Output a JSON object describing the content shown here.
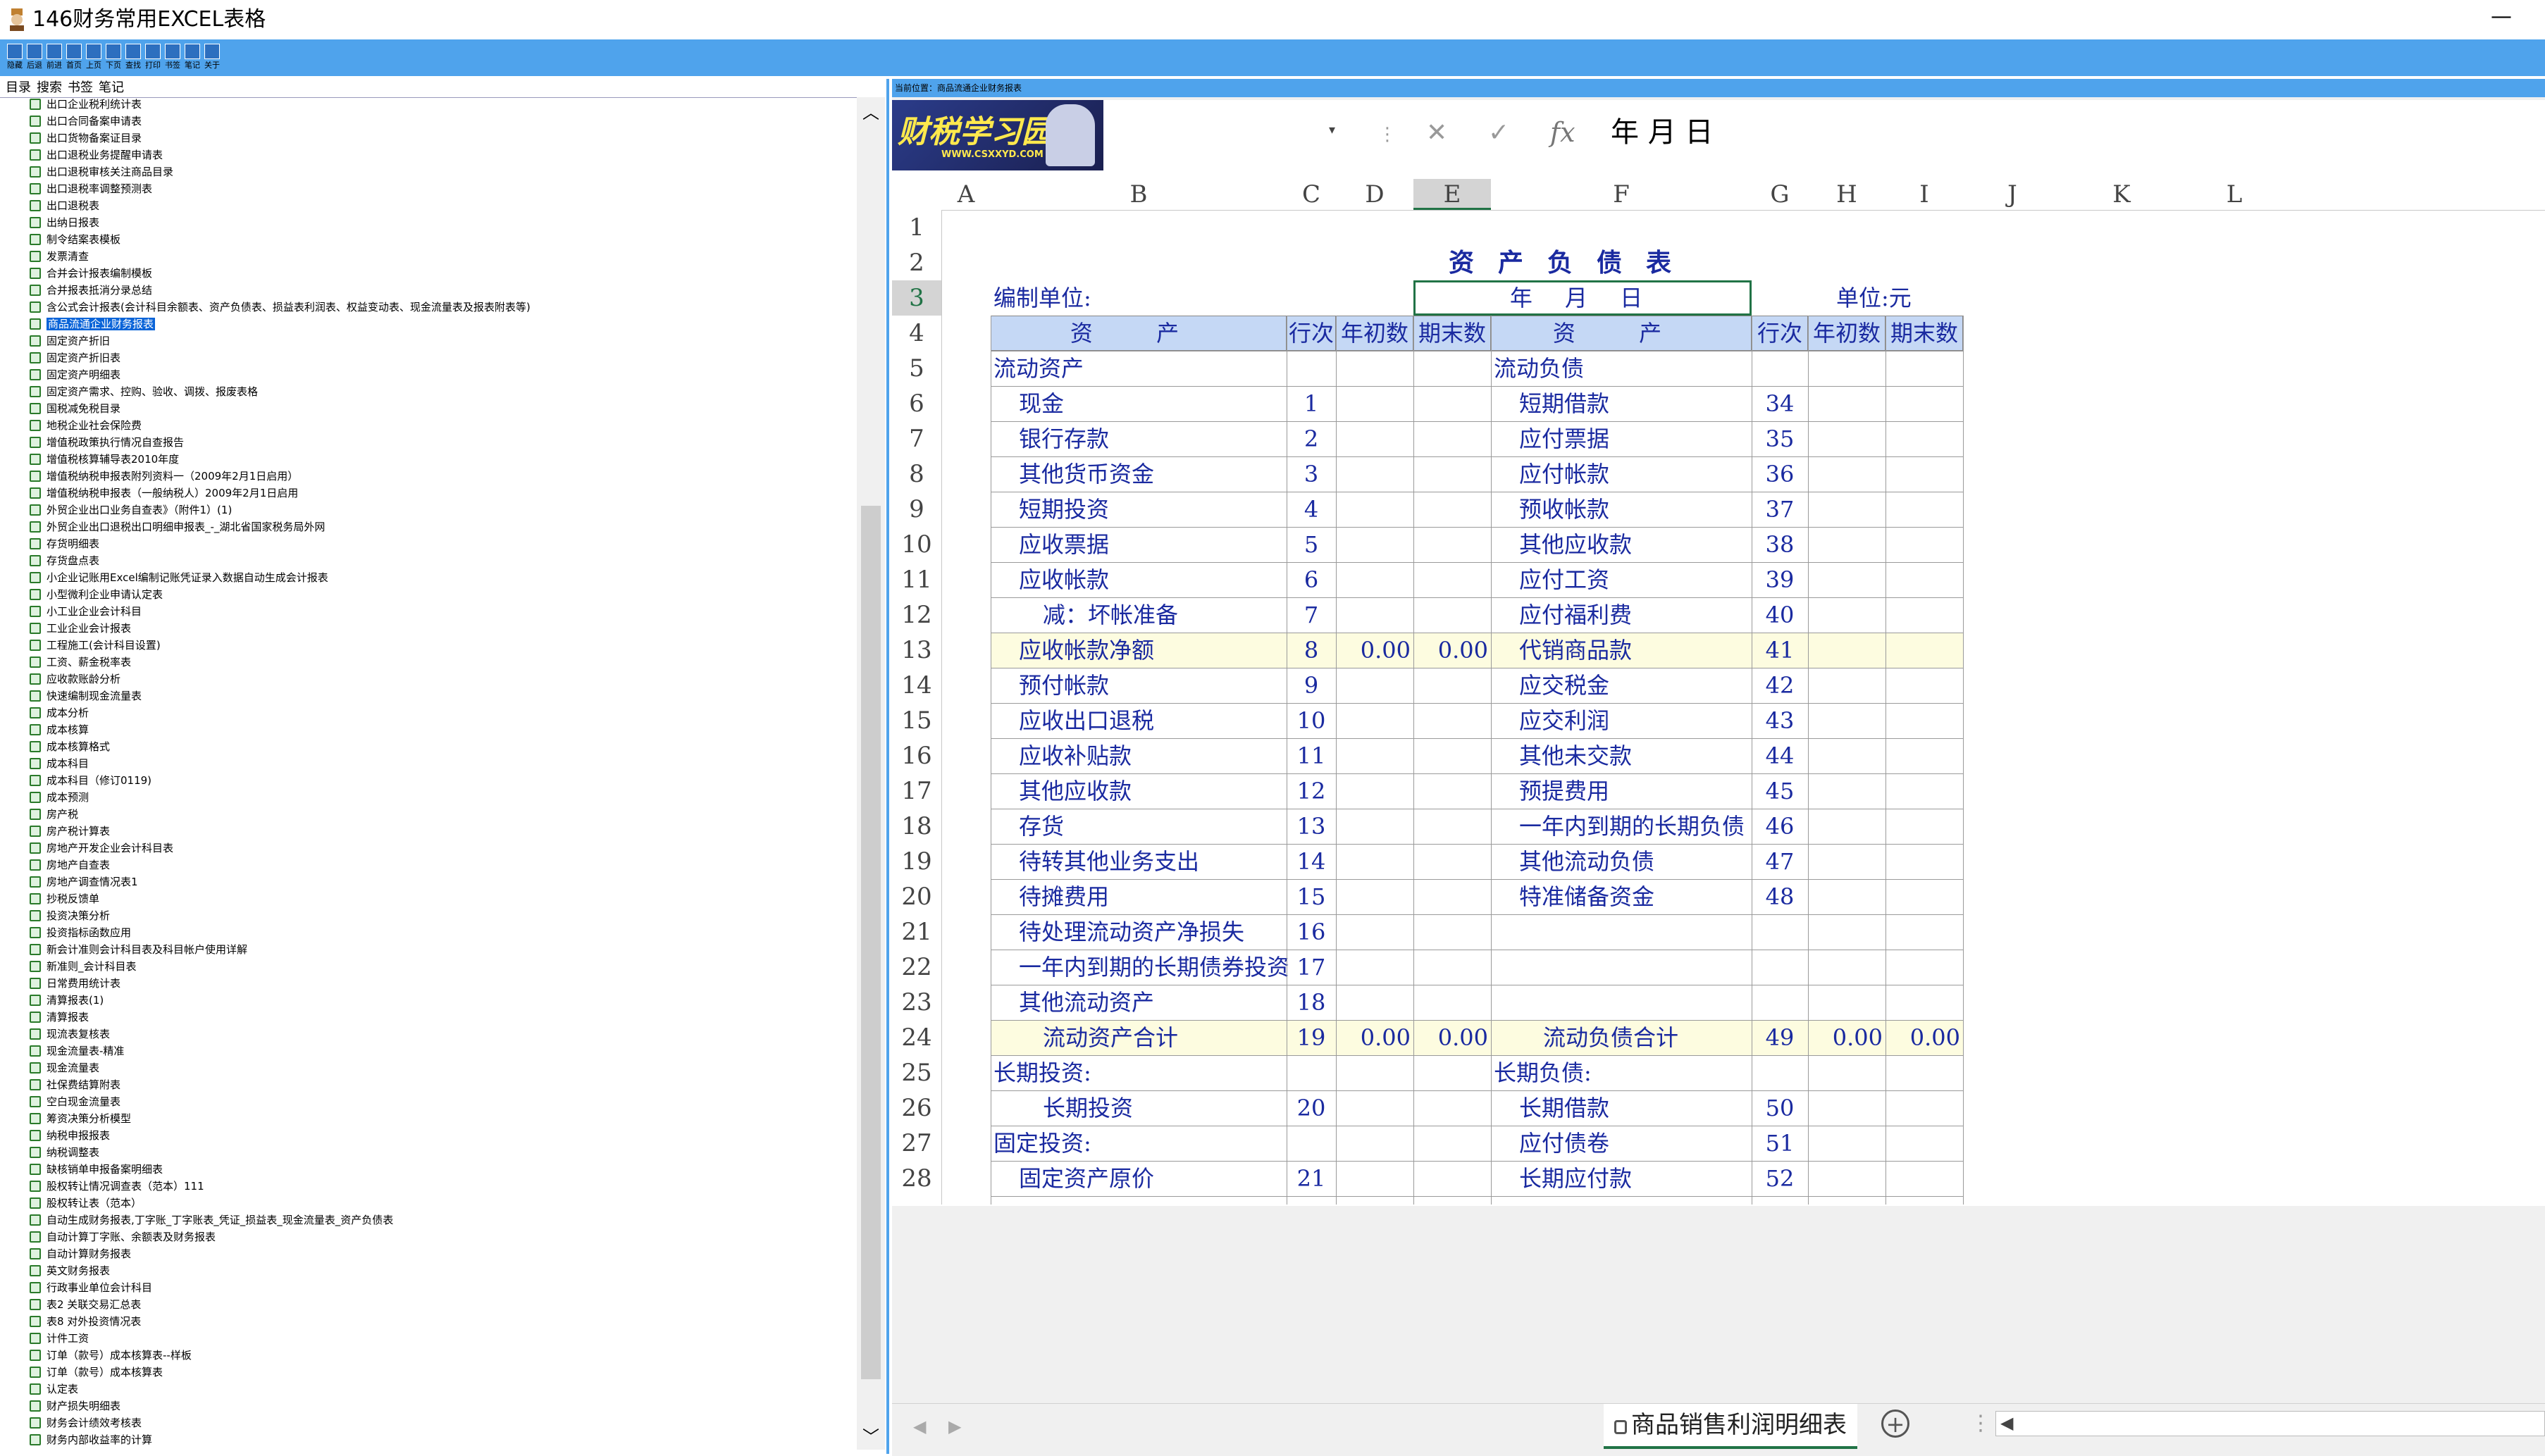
{
  "window": {
    "title": "146财务常用EXCEL表格",
    "minimize": "—"
  },
  "toolbar": {
    "buttons": [
      {
        "label": "隐藏",
        "icon": "hide-icon"
      },
      {
        "label": "后退",
        "icon": "back-icon"
      },
      {
        "label": "前进",
        "icon": "forward-icon"
      },
      {
        "label": "首页",
        "icon": "home-icon"
      },
      {
        "label": "上页",
        "icon": "prev-page-icon"
      },
      {
        "label": "下页",
        "icon": "next-page-icon"
      },
      {
        "label": "查找",
        "icon": "search-icon"
      },
      {
        "label": "打印",
        "icon": "print-icon"
      },
      {
        "label": "书签",
        "icon": "bookmark-icon"
      },
      {
        "label": "笔记",
        "icon": "note-icon"
      },
      {
        "label": "关于",
        "icon": "about-icon"
      }
    ]
  },
  "tree": {
    "tabs": [
      "目录",
      "搜索",
      "书签",
      "笔记"
    ],
    "items": [
      "出口企业税利统计表",
      "出口合同备案申请表",
      "出口货物备案证目录",
      "出口退税业务提醒申请表",
      "出口退税审核关注商品目录",
      "出口退税率调整预测表",
      "出口退税表",
      "出纳日报表",
      "制令结案表模板",
      "发票清查",
      "合并会计报表编制模板",
      "合并报表抵消分录总结",
      "含公式会计报表(会计科目余额表、资产负债表、损益表利润表、权益变动表、现金流量表及报表附表等)",
      "商品流通企业财务报表",
      "固定资产折旧",
      "固定资产折旧表",
      "固定资产明细表",
      "固定资产需求、控购、验收、调拨、报废表格",
      "国税减免税目录",
      "地税企业社会保险费",
      "增值税政策执行情况自查报告",
      "增值税核算辅导表2010年度",
      "增值税纳税申报表附列资料一（2009年2月1日启用）",
      "增值税纳税申报表（一般纳税人）2009年2月1日启用",
      "外贸企业出口业务自查表》（附件1）(1)",
      "外贸企业出口退税出口明细申报表_-_湖北省国家税务局外网",
      "存货明细表",
      "存货盘点表",
      "小企业记账用Excel编制记账凭证录入数据自动生成会计报表",
      "小型微利企业申请认定表",
      "小工业企业会计科目",
      "工业企业会计报表",
      "工程施工(会计科目设置)",
      "工资、薪金税率表",
      "应收款账龄分析",
      "快速编制现金流量表",
      "成本分析",
      "成本核算",
      "成本核算格式",
      "成本科目",
      "成本科目（修订0119)",
      "成本预测",
      "房产税",
      "房产税计算表",
      "房地产开发企业会计科目表",
      "房地产自查表",
      "房地产调查情况表1",
      "抄税反馈单",
      "投资决策分析",
      "投资指标函数应用",
      "新会计准则会计科目表及科目帐户使用详解",
      "新准则_会计科目表",
      "日常费用统计表",
      "清算报表(1)",
      "清算报表",
      "现流表复核表",
      "现金流量表-精准",
      "现金流量表",
      "社保费结算附表",
      "空白现金流量表",
      "筹资决策分析模型",
      "纳税申报报表",
      "纳税调整表",
      "缺核销单申报备案明细表",
      "股权转让情况调查表（范本）111",
      "股权转让表（范本）",
      "自动生成财务报表,丁字账_丁字账表_凭证_损益表_现金流量表_资产负债表",
      "自动计算丁字账、余额表及财务报表",
      "自动计算财务报表",
      "英文财务报表",
      "行政事业单位会计科目",
      "表2 关联交易汇总表",
      "表8 对外投资情况表",
      "计件工资",
      "订单（款号）成本核算表--样板",
      "订单（款号）成本核算表",
      "认定表",
      "财产损失明细表",
      "财务会计绩效考核表",
      "财务内部收益率的计算"
    ],
    "selected_index": 13
  },
  "location_bar": "当前位置：商品流通企业财务报表",
  "logo": {
    "text": "财税学习园地",
    "url_text": "WWW.CSXXYD.COM"
  },
  "formula_bar": {
    "cancel": "✕",
    "confirm": "✓",
    "fx": "fx",
    "value": "年 月 日"
  },
  "columns": [
    "A",
    "B",
    "C",
    "D",
    "E",
    "F",
    "G",
    "H",
    "I",
    "J",
    "K",
    "L"
  ],
  "active_column": "E",
  "rows": [
    "1",
    "2",
    "3",
    "4",
    "5",
    "6",
    "7",
    "8",
    "9",
    "10",
    "11",
    "12",
    "13",
    "14",
    "15",
    "16",
    "17",
    "18",
    "19",
    "20",
    "21",
    "22",
    "23",
    "24",
    "25",
    "26",
    "27",
    "28"
  ],
  "active_row": "3",
  "sheet": {
    "title": "资产负债表",
    "unit_label": "编制单位:",
    "date_placeholder": "年 月 日",
    "currency_label": "单位:元",
    "header": {
      "asset": "资 产",
      "line_no": "行次",
      "begin": "年初数",
      "end": "期末数",
      "liab": "资 产",
      "line_no2": "行次",
      "begin2": "年初数",
      "end2": "期末数"
    },
    "body": [
      {
        "a": "流动资产",
        "an": "",
        "ab": "",
        "ae": "",
        "l": "流动负债",
        "ln": "",
        "lb": "",
        "le": "",
        "a_indent": 0,
        "l_indent": 0,
        "yellow": false
      },
      {
        "a": "现金",
        "an": "1",
        "ab": "",
        "ae": "",
        "l": "短期借款",
        "ln": "34",
        "lb": "",
        "le": "",
        "a_indent": 1,
        "l_indent": 1,
        "yellow": false
      },
      {
        "a": "银行存款",
        "an": "2",
        "ab": "",
        "ae": "",
        "l": "应付票据",
        "ln": "35",
        "lb": "",
        "le": "",
        "a_indent": 1,
        "l_indent": 1,
        "yellow": false
      },
      {
        "a": "其他货币资金",
        "an": "3",
        "ab": "",
        "ae": "",
        "l": "应付帐款",
        "ln": "36",
        "lb": "",
        "le": "",
        "a_indent": 1,
        "l_indent": 1,
        "yellow": false
      },
      {
        "a": "短期投资",
        "an": "4",
        "ab": "",
        "ae": "",
        "l": "预收帐款",
        "ln": "37",
        "lb": "",
        "le": "",
        "a_indent": 1,
        "l_indent": 1,
        "yellow": false
      },
      {
        "a": "应收票据",
        "an": "5",
        "ab": "",
        "ae": "",
        "l": "其他应收款",
        "ln": "38",
        "lb": "",
        "le": "",
        "a_indent": 1,
        "l_indent": 1,
        "yellow": false
      },
      {
        "a": "应收帐款",
        "an": "6",
        "ab": "",
        "ae": "",
        "l": "应付工资",
        "ln": "39",
        "lb": "",
        "le": "",
        "a_indent": 1,
        "l_indent": 1,
        "yellow": false
      },
      {
        "a": "减：坏帐准备",
        "an": "7",
        "ab": "",
        "ae": "",
        "l": "应付福利费",
        "ln": "40",
        "lb": "",
        "le": "",
        "a_indent": 2,
        "l_indent": 1,
        "yellow": false
      },
      {
        "a": "应收帐款净额",
        "an": "8",
        "ab": "0.00",
        "ae": "0.00",
        "l": "代销商品款",
        "ln": "41",
        "lb": "",
        "le": "",
        "a_indent": 1,
        "l_indent": 1,
        "yellow": true
      },
      {
        "a": "预付帐款",
        "an": "9",
        "ab": "",
        "ae": "",
        "l": "应交税金",
        "ln": "42",
        "lb": "",
        "le": "",
        "a_indent": 1,
        "l_indent": 1,
        "yellow": false
      },
      {
        "a": "应收出口退税",
        "an": "10",
        "ab": "",
        "ae": "",
        "l": "应交利润",
        "ln": "43",
        "lb": "",
        "le": "",
        "a_indent": 1,
        "l_indent": 1,
        "yellow": false
      },
      {
        "a": "应收补贴款",
        "an": "11",
        "ab": "",
        "ae": "",
        "l": "其他未交款",
        "ln": "44",
        "lb": "",
        "le": "",
        "a_indent": 1,
        "l_indent": 1,
        "yellow": false
      },
      {
        "a": "其他应收款",
        "an": "12",
        "ab": "",
        "ae": "",
        "l": "预提费用",
        "ln": "45",
        "lb": "",
        "le": "",
        "a_indent": 1,
        "l_indent": 1,
        "yellow": false
      },
      {
        "a": "存货",
        "an": "13",
        "ab": "",
        "ae": "",
        "l": "一年内到期的长期负债",
        "ln": "46",
        "lb": "",
        "le": "",
        "a_indent": 1,
        "l_indent": 1,
        "yellow": false
      },
      {
        "a": "待转其他业务支出",
        "an": "14",
        "ab": "",
        "ae": "",
        "l": "其他流动负债",
        "ln": "47",
        "lb": "",
        "le": "",
        "a_indent": 1,
        "l_indent": 1,
        "yellow": false
      },
      {
        "a": "待摊费用",
        "an": "15",
        "ab": "",
        "ae": "",
        "l": "特准储备资金",
        "ln": "48",
        "lb": "",
        "le": "",
        "a_indent": 1,
        "l_indent": 1,
        "yellow": false
      },
      {
        "a": "待处理流动资产净损失",
        "an": "16",
        "ab": "",
        "ae": "",
        "l": "",
        "ln": "",
        "lb": "",
        "le": "",
        "a_indent": 1,
        "l_indent": 1,
        "yellow": false
      },
      {
        "a": "一年内到期的长期债券投资",
        "an": "17",
        "ab": "",
        "ae": "",
        "l": "",
        "ln": "",
        "lb": "",
        "le": "",
        "a_indent": 1,
        "l_indent": 1,
        "yellow": false
      },
      {
        "a": "其他流动资产",
        "an": "18",
        "ab": "",
        "ae": "",
        "l": "",
        "ln": "",
        "lb": "",
        "le": "",
        "a_indent": 1,
        "l_indent": 1,
        "yellow": false
      },
      {
        "a": "流动资产合计",
        "an": "19",
        "ab": "0.00",
        "ae": "0.00",
        "l": "流动负债合计",
        "ln": "49",
        "lb": "0.00",
        "le": "0.00",
        "a_indent": 2,
        "l_indent": 2,
        "yellow": true
      },
      {
        "a": "长期投资:",
        "an": "",
        "ab": "",
        "ae": "",
        "l": "长期负债:",
        "ln": "",
        "lb": "",
        "le": "",
        "a_indent": 0,
        "l_indent": 0,
        "yellow": false
      },
      {
        "a": "长期投资",
        "an": "20",
        "ab": "",
        "ae": "",
        "l": "长期借款",
        "ln": "50",
        "lb": "",
        "le": "",
        "a_indent": 2,
        "l_indent": 1,
        "yellow": false
      },
      {
        "a": "固定投资:",
        "an": "",
        "ab": "",
        "ae": "",
        "l": "应付债卷",
        "ln": "51",
        "lb": "",
        "le": "",
        "a_indent": 0,
        "l_indent": 1,
        "yellow": false
      },
      {
        "a": "固定资产原价",
        "an": "21",
        "ab": "",
        "ae": "",
        "l": "长期应付款",
        "ln": "52",
        "lb": "",
        "le": "",
        "a_indent": 1,
        "l_indent": 1,
        "yellow": false
      }
    ]
  },
  "tabbar": {
    "sheet_name": "商品销售利润明细表",
    "add": "+",
    "dots": "⋮",
    "prev": "◀",
    "next": "▶",
    "scroll_left": "◀"
  }
}
